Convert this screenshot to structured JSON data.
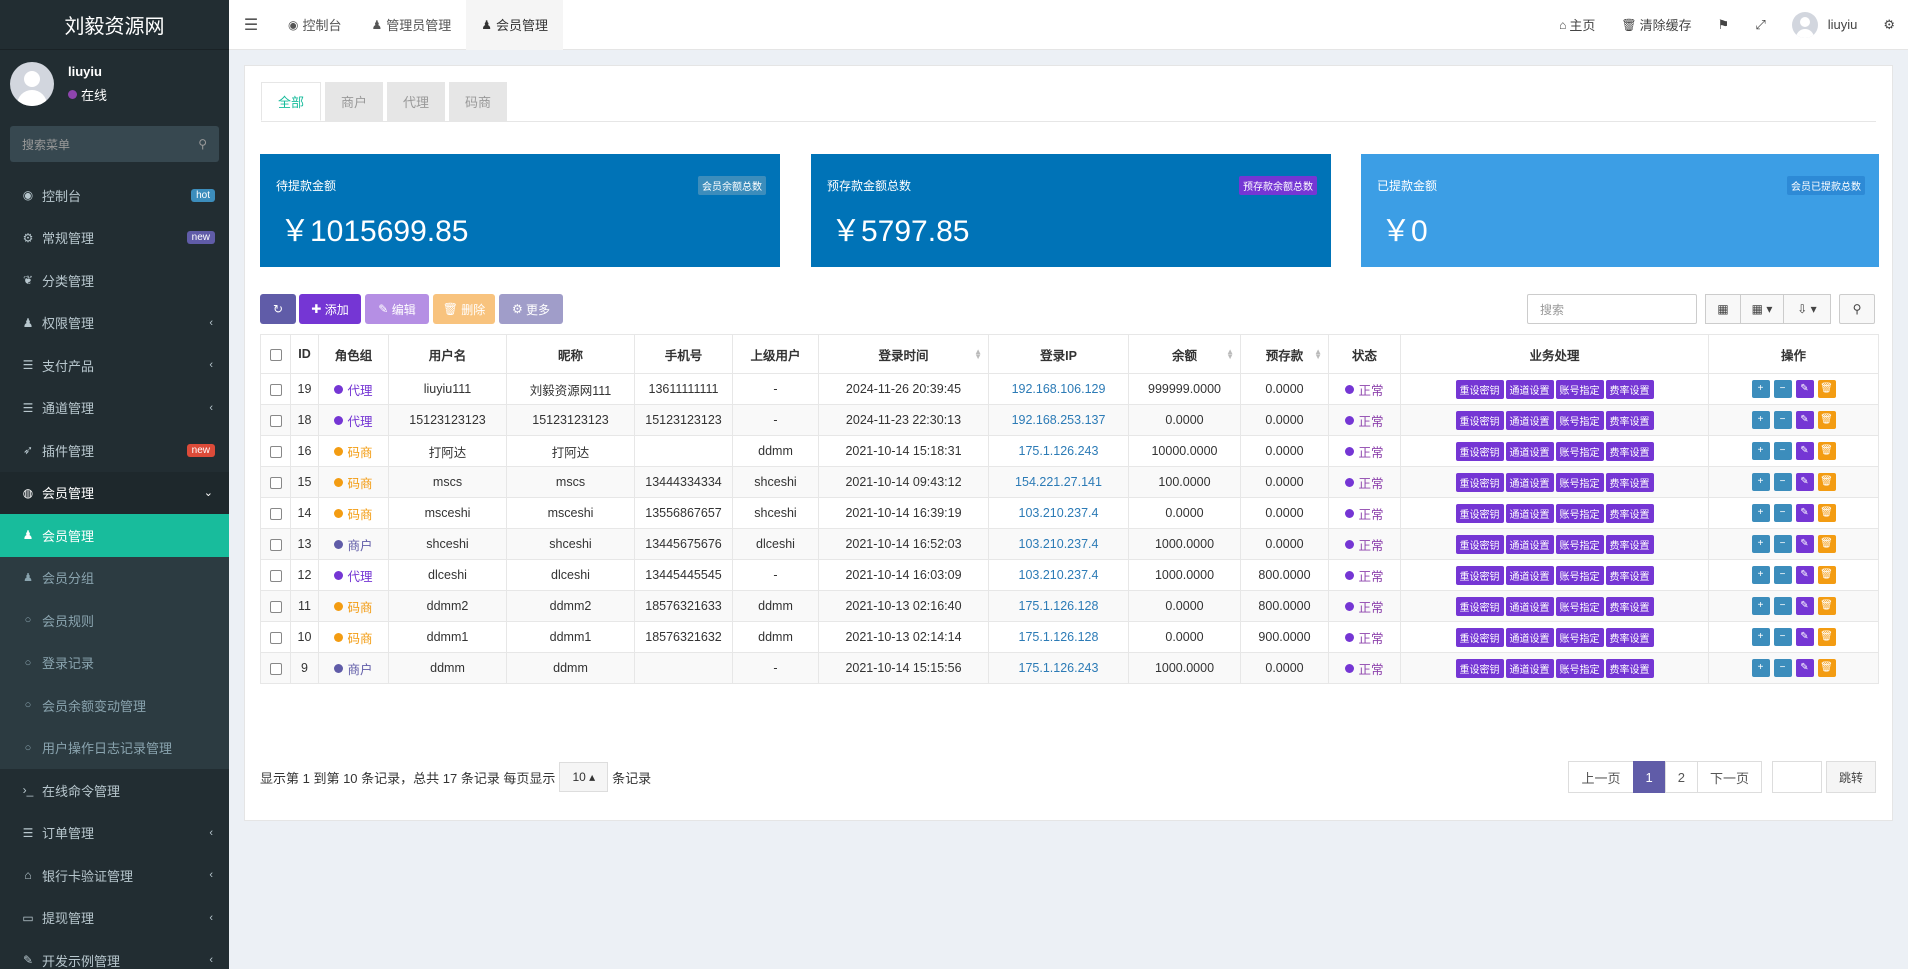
{
  "brand": "刘毅资源网",
  "user": {
    "name": "liuyiu",
    "status": "在线",
    "status_color": "#8e44ad"
  },
  "sidebar": {
    "search_placeholder": "搜索菜单",
    "items": [
      {
        "label": "控制台",
        "icon": "dashboard-icon",
        "badge": "hot",
        "badge_color": "#3c8dbc"
      },
      {
        "label": "常规管理",
        "icon": "cogs-icon",
        "badge": "new",
        "badge_color": "#605ca8"
      },
      {
        "label": "分类管理",
        "icon": "leaf-icon"
      },
      {
        "label": "权限管理",
        "icon": "group-icon",
        "arrow": "‹"
      },
      {
        "label": "支付产品",
        "icon": "list-icon",
        "arrow": "‹"
      },
      {
        "label": "通道管理",
        "icon": "list-icon",
        "arrow": "‹"
      },
      {
        "label": "插件管理",
        "icon": "rocket-icon",
        "badge": "new",
        "badge_color": "#dd4b39"
      },
      {
        "label": "会员管理",
        "icon": "user-circle-icon",
        "arrow": "⌄"
      },
      {
        "label": "会员管理",
        "icon": "user-icon"
      },
      {
        "label": "会员分组",
        "icon": "users-icon"
      },
      {
        "label": "会员规则",
        "icon": "circle-o-icon"
      },
      {
        "label": "登录记录",
        "icon": "circle-o-icon"
      },
      {
        "label": "会员余额变动管理",
        "icon": "circle-o-icon"
      },
      {
        "label": "用户操作日志记录管理",
        "icon": "circle-o-icon"
      },
      {
        "label": "在线命令管理",
        "icon": "terminal-icon"
      },
      {
        "label": "订单管理",
        "icon": "list-icon",
        "arrow": "‹"
      },
      {
        "label": "银行卡验证管理",
        "icon": "bank-icon",
        "arrow": "‹"
      },
      {
        "label": "提现管理",
        "icon": "visa-icon",
        "arrow": "‹"
      },
      {
        "label": "开发示例管理",
        "icon": "magic-icon",
        "arrow": "‹"
      }
    ]
  },
  "topbar": {
    "tabs": [
      {
        "label": "控制台",
        "icon": "dashboard-icon"
      },
      {
        "label": "管理员管理",
        "icon": "user-icon"
      },
      {
        "label": "会员管理",
        "icon": "user-icon"
      }
    ],
    "home": "主页",
    "clear_cache": "清除缓存",
    "username": "liuyiu"
  },
  "subtabs": [
    "全部",
    "商户",
    "代理",
    "码商"
  ],
  "stats": [
    {
      "label": "待提款金额",
      "tag": "会员余额总数",
      "value": "￥1015699.85",
      "bg": "#0073b7",
      "tag_bg": "#3c8dbc"
    },
    {
      "label": "预存款金额总数",
      "tag": "预存款余额总数",
      "value": "￥5797.85",
      "bg": "#0073b7",
      "tag_bg": "#7536d4"
    },
    {
      "label": "已提款金额",
      "tag": "会员已提款总数",
      "value": "￥0",
      "bg": "#3c9ee5",
      "tag_bg": "#2d8ad6"
    }
  ],
  "toolbar": {
    "add": "添加",
    "edit": "编辑",
    "delete": "删除",
    "more": "更多",
    "search_placeholder": "搜索"
  },
  "table": {
    "headers": [
      "ID",
      "角色组",
      "用户名",
      "昵称",
      "手机号",
      "上级用户",
      "登录时间",
      "登录IP",
      "余额",
      "预存款",
      "状态",
      "业务处理",
      "操作"
    ],
    "rows": [
      {
        "id": "19",
        "role": "代理",
        "role_color": "#7536d4",
        "username": "liuyiu111",
        "nickname": "刘毅资源网111",
        "mobile": "13611111111",
        "parent": "-",
        "login_time": "2024-11-26 20:39:45",
        "ip": "192.168.106.129",
        "balance": "999999.0000",
        "deposit": "0.0000",
        "status": "正常"
      },
      {
        "id": "18",
        "role": "代理",
        "role_color": "#7536d4",
        "username": "15123123123",
        "nickname": "15123123123",
        "mobile": "15123123123",
        "parent": "-",
        "login_time": "2024-11-23 22:30:13",
        "ip": "192.168.253.137",
        "balance": "0.0000",
        "deposit": "0.0000",
        "status": "正常"
      },
      {
        "id": "16",
        "role": "码商",
        "role_color": "#f39c12",
        "username": "打阿达",
        "nickname": "打阿达",
        "mobile": "",
        "parent": "ddmm",
        "login_time": "2021-10-14 15:18:31",
        "ip": "175.1.126.243",
        "balance": "10000.0000",
        "deposit": "0.0000",
        "status": "正常"
      },
      {
        "id": "15",
        "role": "码商",
        "role_color": "#f39c12",
        "username": "mscs",
        "nickname": "mscs",
        "mobile": "13444334334",
        "parent": "shceshi",
        "login_time": "2021-10-14 09:43:12",
        "ip": "154.221.27.141",
        "balance": "100.0000",
        "deposit": "0.0000",
        "status": "正常"
      },
      {
        "id": "14",
        "role": "码商",
        "role_color": "#f39c12",
        "username": "msceshi",
        "nickname": "msceshi",
        "mobile": "13556867657",
        "parent": "shceshi",
        "login_time": "2021-10-14 16:39:19",
        "ip": "103.210.237.4",
        "balance": "0.0000",
        "deposit": "0.0000",
        "status": "正常"
      },
      {
        "id": "13",
        "role": "商户",
        "role_color": "#605ca8",
        "username": "shceshi",
        "nickname": "shceshi",
        "mobile": "13445675676",
        "parent": "dlceshi",
        "login_time": "2021-10-14 16:52:03",
        "ip": "103.210.237.4",
        "balance": "1000.0000",
        "deposit": "0.0000",
        "status": "正常"
      },
      {
        "id": "12",
        "role": "代理",
        "role_color": "#7536d4",
        "username": "dlceshi",
        "nickname": "dlceshi",
        "mobile": "13445445545",
        "parent": "-",
        "login_time": "2021-10-14 16:03:09",
        "ip": "103.210.237.4",
        "balance": "1000.0000",
        "deposit": "800.0000",
        "status": "正常"
      },
      {
        "id": "11",
        "role": "码商",
        "role_color": "#f39c12",
        "username": "ddmm2",
        "nickname": "ddmm2",
        "mobile": "18576321633",
        "parent": "ddmm",
        "login_time": "2021-10-13 02:16:40",
        "ip": "175.1.126.128",
        "balance": "0.0000",
        "deposit": "800.0000",
        "status": "正常"
      },
      {
        "id": "10",
        "role": "码商",
        "role_color": "#f39c12",
        "username": "ddmm1",
        "nickname": "ddmm1",
        "mobile": "18576321632",
        "parent": "ddmm",
        "login_time": "2021-10-13 02:14:14",
        "ip": "175.1.126.128",
        "balance": "0.0000",
        "deposit": "900.0000",
        "status": "正常"
      },
      {
        "id": "9",
        "role": "商户",
        "role_color": "#605ca8",
        "username": "ddmm",
        "nickname": "ddmm",
        "mobile": "",
        "parent": "-",
        "login_time": "2021-10-14 15:15:56",
        "ip": "175.1.126.243",
        "balance": "1000.0000",
        "deposit": "0.0000",
        "status": "正常"
      }
    ],
    "biz_buttons": [
      "重设密钥",
      "通道设置",
      "账号指定",
      "费率设置"
    ]
  },
  "footer": {
    "info_prefix": "显示第 1 到第 10 条记录，总共 17 条记录 每页显示",
    "page_size": "10",
    "info_suffix": "条记录",
    "prev": "上一页",
    "pages": [
      "1",
      "2"
    ],
    "next": "下一页",
    "jump": "跳转"
  }
}
